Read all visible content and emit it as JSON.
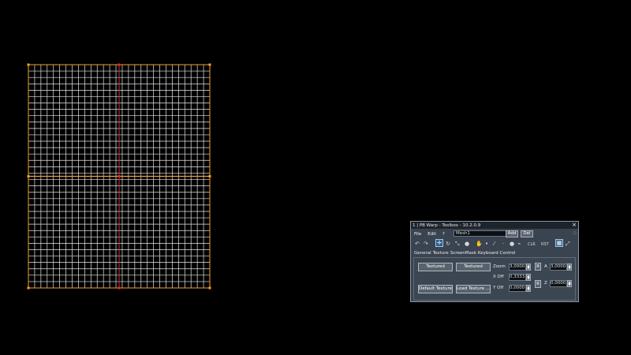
{
  "window": {
    "title": "1 | PB Warp - Toolbox - 10.2.0.9",
    "close_glyph": "×"
  },
  "menu": {
    "file": "File",
    "edit": "Edit",
    "help": "?",
    "mesh_selected": "Mesh1",
    "add": "Add",
    "del": "Del"
  },
  "toolbar": {
    "clr": "CLR",
    "rst": "RST"
  },
  "tabs": [
    "General",
    "Texture",
    "ScreenMask",
    "Keyboard Control"
  ],
  "texture_panel": {
    "btn_textured_1": "Textured",
    "btn_textured_2": "Textured",
    "btn_default_texture": "Default Texture",
    "btn_load_texture": "Load Texture ...",
    "zoom_label": "Zoom",
    "zoom_value": "3,0000",
    "xoff_label": "X Off",
    "xoff_value": "0,3333",
    "yoff_label": "Y Off",
    "yoff_value": "0,0000",
    "r_label": "R",
    "a_label": "A",
    "a_value": "3,0000",
    "z_label": "Z",
    "z_value": "0,0000"
  },
  "mesh": {
    "columns": 29,
    "rows": 35,
    "colors": {
      "border": "#f2a12e",
      "grid": "#e6e6e6",
      "center_v": "#c0392b",
      "center_h": "#f2a12e",
      "handle": "#ff2222"
    }
  }
}
